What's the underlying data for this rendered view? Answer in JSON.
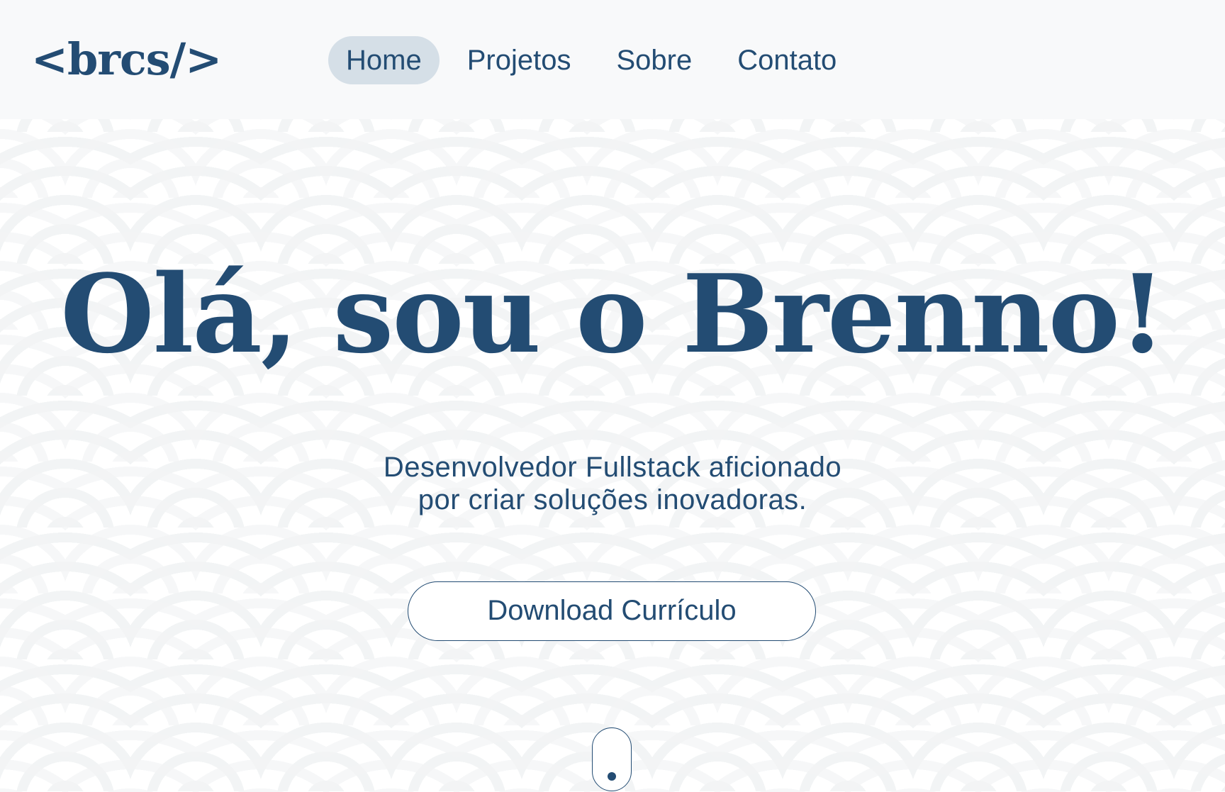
{
  "navbar": {
    "logo": "<brcs/>",
    "items": [
      {
        "label": "Home",
        "active": true
      },
      {
        "label": "Projetos",
        "active": false
      },
      {
        "label": "Sobre",
        "active": false
      },
      {
        "label": "Contato",
        "active": false
      }
    ]
  },
  "hero": {
    "title": "Olá, sou o Brenno!",
    "subtitle_line1": "Desenvolvedor Fullstack aficionado",
    "subtitle_line2": "por criar soluções inovadoras.",
    "cv_button_label": "Download Currículo",
    "scroll_icon": "mouse-scroll-icon"
  },
  "colors": {
    "primary": "#234c73",
    "navbar_bg": "#f8f9fa",
    "active_pill": "#d5dfe7",
    "pattern": "#f2f4f5"
  }
}
